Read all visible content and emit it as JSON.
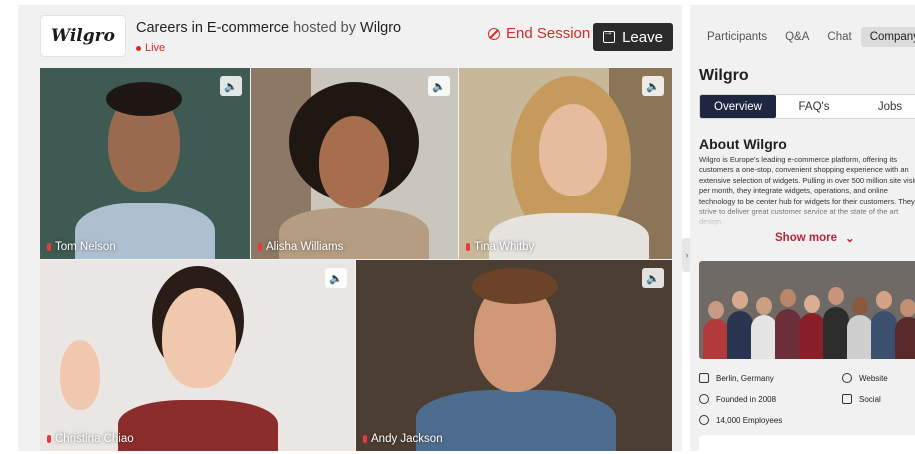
{
  "header": {
    "logo_text": "Wilgro",
    "title_main": "Careers in E-commerce",
    "title_hosted": " hosted by ",
    "title_host": "Wilgro",
    "live_label": "Live",
    "end_session_label": "End Session",
    "leave_label": "Leave"
  },
  "participants": [
    {
      "name": "Tom Nelson",
      "audio_icon": "speaker-icon"
    },
    {
      "name": "Alisha Williams",
      "audio_icon": "speaker-icon"
    },
    {
      "name": "Tina Whitby",
      "audio_icon": "speaker-icon"
    },
    {
      "name": "Christina Chiao",
      "audio_icon": "speaker-icon"
    },
    {
      "name": "Andy Jackson",
      "audio_icon": "speaker-icon"
    }
  ],
  "sidebar": {
    "tabs": [
      "Participants",
      "Q&A",
      "Chat",
      "Company"
    ],
    "active_tab": "Company",
    "company_name": "Wilgro",
    "subtabs": [
      "Overview",
      "FAQ's",
      "Jobs"
    ],
    "active_subtab": "Overview",
    "about_title": "About Wilgro",
    "about_text": "Wilgro is Europe's leading e-commerce platform, offering its customers a one-stop, convenient shopping experience with an extensive selection of widgets. Pulling in over 500 million site visits per month, they integrate widgets, operations, and online technology to be center hub for widgets for their customers. They strive to deliver great customer service at the state of the art design.",
    "show_more_label": "Show more",
    "facts": {
      "location": "Berlin, Germany",
      "website": "Website",
      "founded": "Founded in 2008",
      "social": "Social",
      "employees": "14,000 Employees"
    }
  },
  "colors": {
    "accent_red": "#d32a2a",
    "leave_button": "#2b2b2b",
    "active_subtab": "#1f2740",
    "show_more": "#b3263a"
  }
}
